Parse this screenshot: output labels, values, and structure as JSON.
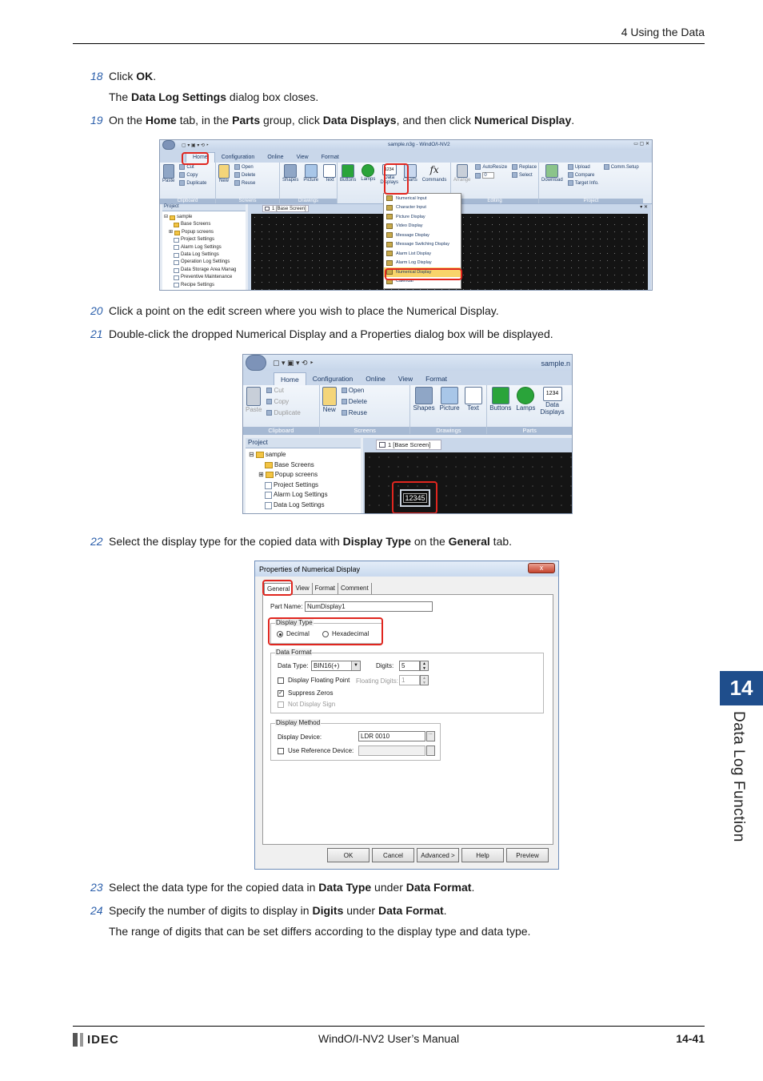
{
  "header": {
    "section": "4 Using the Data"
  },
  "footer": {
    "logo": "IDEC",
    "manual": "WindO/I-NV2 User’s Manual",
    "page": "14-41"
  },
  "chapter": {
    "number": "14",
    "title": "Data Log Function"
  },
  "steps": {
    "s18": {
      "num": "18",
      "a": "Click ",
      "b": "OK",
      "c": ".",
      "sub_a": "The ",
      "sub_b": "Data Log Settings",
      "sub_c": " dialog box closes."
    },
    "s19": {
      "num": "19",
      "a": "On the ",
      "b": "Home",
      "c": " tab, in the ",
      "d": "Parts",
      "e": " group, click ",
      "f": "Data Displays",
      "g": ", and then click ",
      "h": "Numerical Display",
      "i": "."
    },
    "s20": {
      "num": "20",
      "text": "Click a point on the edit screen where you wish to place the Numerical Display."
    },
    "s21": {
      "num": "21",
      "text": "Double-click the dropped Numerical Display and a Properties dialog box will be displayed."
    },
    "s22": {
      "num": "22",
      "a": "Select the display type for the copied data with ",
      "b": "Display Type",
      "c": " on the ",
      "d": "General",
      "e": " tab."
    },
    "s23": {
      "num": "23",
      "a": "Select the data type for the copied data in ",
      "b": "Data Type",
      "c": " under ",
      "d": "Data Format",
      "e": "."
    },
    "s24": {
      "num": "24",
      "a": "Specify the number of digits to display in ",
      "b": "Digits",
      "c": " under ",
      "d": "Data Format",
      "e": ".",
      "sub": "The range of digits that can be set differs according to the display type and data type."
    }
  },
  "shot1": {
    "title": "sample.n3g - WindO/I-NV2",
    "tabs": [
      "Home",
      "Configuration",
      "Online",
      "View",
      "Format"
    ],
    "clipboard": {
      "paste": "Paste",
      "cut": "Cut",
      "copy": "Copy",
      "duplicate": "Duplicate",
      "label": "Clipboard"
    },
    "screens": {
      "new": "New",
      "open": "Open",
      "delete": "Delete",
      "reuse": "Reuse",
      "label": "Screens"
    },
    "drawings": {
      "shapes": "Shapes",
      "picture": "Picture",
      "text": "Text",
      "label": "Drawings"
    },
    "parts": {
      "buttons": "Buttons",
      "lamps": "Lamps",
      "data": "Data",
      "displays": "Displays",
      "charts": "Charts",
      "commands": "Commands",
      "icon_text": "1234",
      "fx": "fx"
    },
    "editing": {
      "arrange": "Arrange",
      "autoresize": "AutoResize",
      "replace": "Replace",
      "select": "Select",
      "spin": "0",
      "label": "Editing"
    },
    "project": {
      "download": "Download",
      "upload": "Upload",
      "compare": "Compare",
      "target": "Target Info.",
      "comm": "Comm.Setup",
      "label": "Project"
    },
    "panel_title": "Project",
    "sheet_tab": "1  [Base Screen]",
    "tree": [
      "sample",
      "Base Screens",
      "Popup screens",
      "Project Settings",
      "Alarm Log Settings",
      "Data Log Settings",
      "Operation Log Settings",
      "Data Storage Area Manag",
      "Preventive Maintenance",
      "Recipe Settings"
    ],
    "menu": [
      "Numerical Input",
      "Character Input",
      "Picture Display",
      "Video Display",
      "Message Display",
      "Message Switching Display",
      "Alarm List Display",
      "Alarm Log Display",
      "Numerical Display",
      "Calendar"
    ]
  },
  "shot2": {
    "title": "sample.n",
    "tabs": [
      "Home",
      "Configuration",
      "Online",
      "View",
      "Format"
    ],
    "clipboard": {
      "paste": "Paste",
      "cut": "Cut",
      "copy": "Copy",
      "duplicate": "Duplicate",
      "label": "Clipboard"
    },
    "screens": {
      "new": "New",
      "open": "Open",
      "delete": "Delete",
      "reuse": "Reuse",
      "label": "Screens"
    },
    "drawings": {
      "shapes": "Shapes",
      "picture": "Picture",
      "text": "Text",
      "label": "Drawings"
    },
    "parts": {
      "buttons": "Buttons",
      "lamps": "Lamps",
      "data": "Data",
      "displays": "Displays",
      "icon_text": "1234",
      "label": "Parts"
    },
    "panel_title": "Project",
    "sheet_tab": "1  [Base Screen]",
    "tree": [
      "sample",
      "Base Screens",
      "Popup screens",
      "Project Settings",
      "Alarm Log Settings",
      "Data Log Settings"
    ],
    "numeric": "12345"
  },
  "dialog": {
    "title": "Properties of Numerical Display",
    "close": "x",
    "tabs": [
      "General",
      "View",
      "Format",
      "Comment"
    ],
    "part_name_label": "Part Name:",
    "part_name": "NumDisplay1",
    "display_type": {
      "legend": "Display Type",
      "decimal": "Decimal",
      "hex": "Hexadecimal"
    },
    "data_format": {
      "legend": "Data Format",
      "data_type_label": "Data Type:",
      "data_type": "BIN16(+)",
      "digits_label": "Digits:",
      "digits": "5",
      "floating_label": "Display Floating Point",
      "floating_digits_label": "Floating Digits:",
      "floating_digits": "1",
      "suppress": "Suppress Zeros",
      "no_sign": "Not Display Sign"
    },
    "display_method": {
      "legend": "Display Method",
      "device_label": "Display Device:",
      "device": "LDR 0010",
      "ref_label": "Use Reference Device:"
    },
    "buttons": [
      "OK",
      "Cancel",
      "Advanced >",
      "Help",
      "Preview"
    ]
  }
}
